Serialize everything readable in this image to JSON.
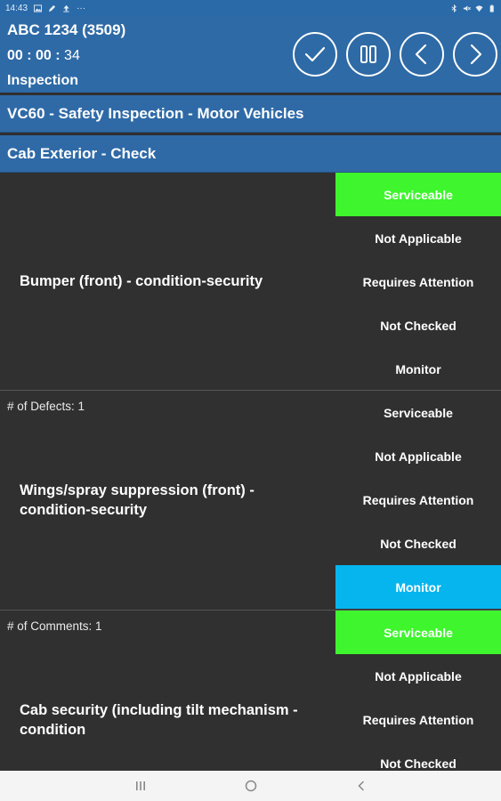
{
  "status_bar": {
    "time": "14:43",
    "overflow": "···"
  },
  "header": {
    "vehicle": "ABC 1234 (3509)",
    "timer_hm": "00 : 00 :",
    "timer_s": "34",
    "mode": "Inspection"
  },
  "form_title": "VC60 - Safety Inspection - Motor Vehicles",
  "section_title": "Cab Exterior - Check",
  "items": [
    {
      "label": "Bumper (front) - condition-security",
      "meta": "",
      "selected": "Serviceable"
    },
    {
      "label": "Wings/spray suppression (front) - condition-security",
      "meta": "# of Defects: 1",
      "selected": "Monitor"
    },
    {
      "label": "Cab security (including tilt mechanism - condition",
      "meta": "# of Comments: 1",
      "selected": "Serviceable"
    }
  ],
  "options": [
    "Serviceable",
    "Not Applicable",
    "Requires Attention",
    "Not Checked",
    "Monitor"
  ],
  "colors": {
    "header": "#2e6aa6",
    "serviceable": "#3ef52e",
    "monitor": "#06b5ee",
    "row_bg": "#303030"
  },
  "icons": [
    "check-icon",
    "pause-icon",
    "chevron-left-icon",
    "chevron-right-icon",
    "recents-nav-icon",
    "home-nav-icon",
    "back-nav-icon"
  ]
}
